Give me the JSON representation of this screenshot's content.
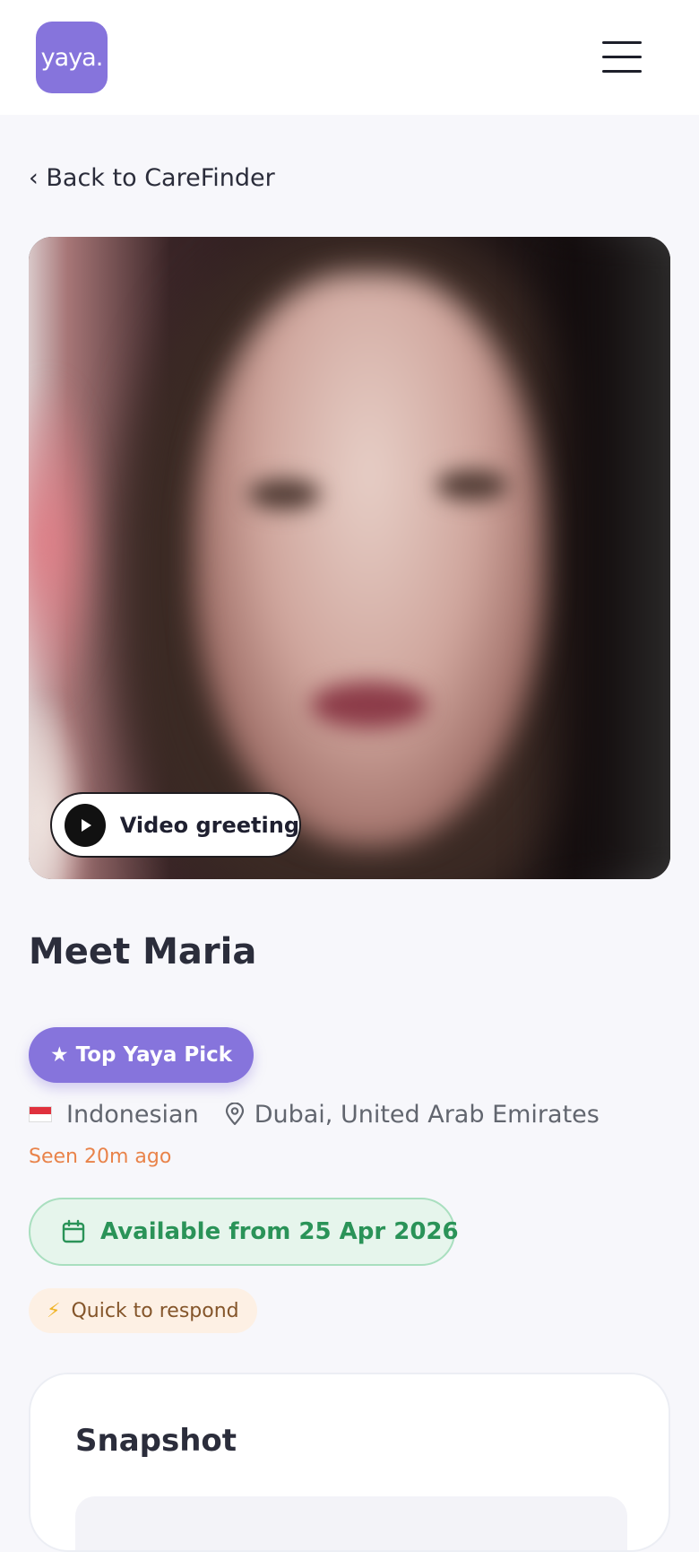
{
  "header": {
    "logo_text": "yaya.",
    "menu_icon": "hamburger-menu-icon"
  },
  "nav": {
    "back_label": "‹ Back to CareFinder"
  },
  "profile": {
    "video_greeting_label": "Video greeting",
    "name": "Meet Maria",
    "badge_label": "★ Top Yaya Pick",
    "nationality": "Indonesian",
    "location": "Dubai, United Arab Emirates",
    "last_seen": "Seen 20m ago",
    "availability": "Available from 25 Apr 2026",
    "response_tag": "Quick to respond"
  },
  "snapshot": {
    "title": "Snapshot"
  },
  "colors": {
    "brand": "#8674dc",
    "available_green": "#2a9358",
    "seen_orange": "#e9834a",
    "quick_bg": "#fdf0e4"
  }
}
